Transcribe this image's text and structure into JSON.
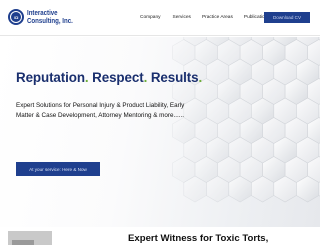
{
  "header": {
    "logo": {
      "line1": "Interactive",
      "line2": "Consulting, Inc.",
      "mark": "ICI"
    },
    "nav": [
      {
        "label": "Company"
      },
      {
        "label": "Services"
      },
      {
        "label": "Practice Areas"
      },
      {
        "label": "Publications"
      }
    ],
    "download_label": "Download CV"
  },
  "hero": {
    "headline": {
      "part1": "Reputation",
      "part2": "Respect",
      "part3": "Results",
      "dot": "."
    },
    "subtext": "Expert Solutions for Personal Injury & Product Liability, Early Matter & Case Development, Attorney Mentoring & more......",
    "cta_label": "At your service: Here & Now"
  },
  "below": {
    "heading": "Expert Witness for Toxic Torts,"
  },
  "colors": {
    "brand_blue": "#1f3f8e",
    "headline_navy": "#1a2f6e",
    "accent_green": "#6fae3a"
  }
}
